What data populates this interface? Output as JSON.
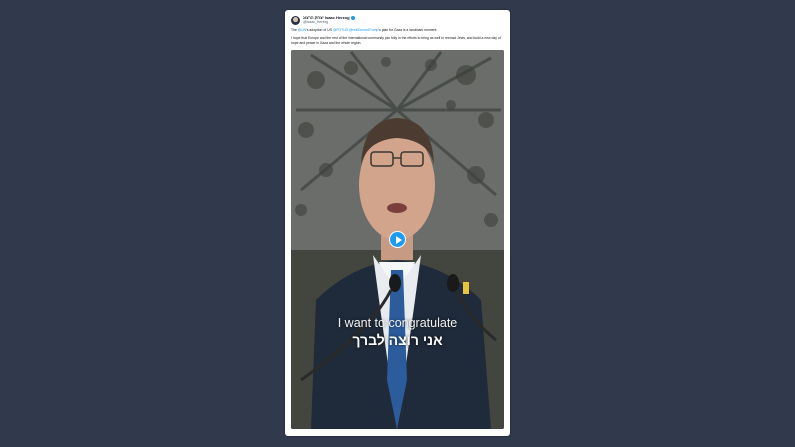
{
  "tweet": {
    "author": {
      "display_name": "יצחק הרצוג Isaac Herzog",
      "handle": "@Isaac_Herzog",
      "verified": true,
      "avatar_icon": "avatar-photo"
    },
    "paragraphs": [
      {
        "segments": [
          {
            "text": "The ",
            "type": "text"
          },
          {
            "text": "@UN",
            "type": "mention"
          },
          {
            "text": "'s adoption of US ",
            "type": "text"
          },
          {
            "text": "@POTUS",
            "type": "mention"
          },
          {
            "text": " ",
            "type": "text"
          },
          {
            "text": "@realDonaldTrump",
            "type": "mention"
          },
          {
            "text": "'s plan for Gaza is a landmark moment.",
            "type": "text"
          }
        ]
      },
      {
        "segments": [
          {
            "text": "I hope that Europe and the rest of the international community join fully in the efforts to bring as well to reenact Jews, and build a new day of hope and peace in Gaza and the whole region.",
            "type": "text"
          }
        ]
      }
    ],
    "video": {
      "caption_english": "I want to congratulate",
      "caption_hebrew": "אני רוצה לברך",
      "play_icon": "play-icon"
    }
  },
  "colors": {
    "background": "#303a4c",
    "card": "#ffffff",
    "accent": "#1d9bf0"
  }
}
